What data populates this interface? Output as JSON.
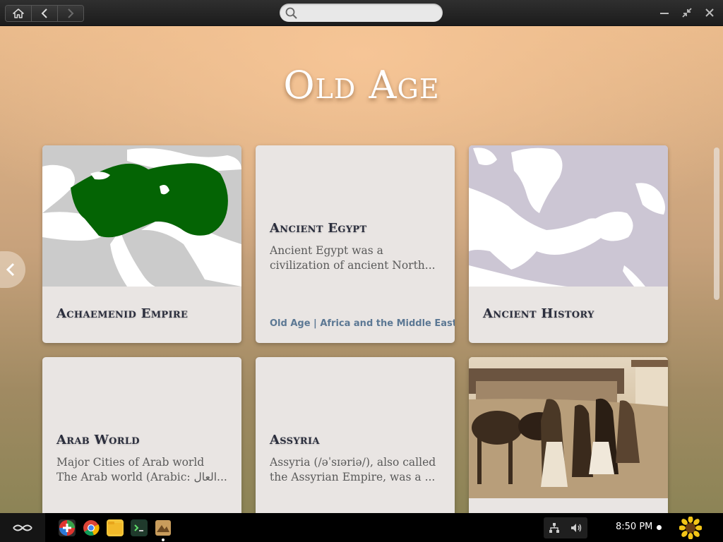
{
  "topbar": {
    "search": {
      "value": "",
      "placeholder": ""
    },
    "icons": {
      "home": "home-icon",
      "back": "back-arrow-icon",
      "forward": "forward-arrow-icon",
      "search": "search-icon",
      "minimize": "minimize-icon",
      "unmaximize": "unmaximize-icon",
      "close": "close-icon"
    }
  },
  "page": {
    "title": "Old Age"
  },
  "cards": [
    {
      "title": "Achaemenid Empire",
      "image": "map-achaemenid-empire"
    },
    {
      "title": "Ancient Egypt",
      "desc_line1": "Ancient Egypt was a",
      "desc_line2": "civilization of ancient North...",
      "meta": "Old Age | Africa and the Middle East"
    },
    {
      "title": "Ancient History",
      "image": "map-europe-mediterranean"
    },
    {
      "title": "Arab World",
      "desc_line1": "Major Cities of Arab world",
      "desc_line2": "The Arab world (Arabic: العال..."
    },
    {
      "title": "Assyria",
      "desc_line1": "Assyria (/əˈsɪəriə/), also called",
      "desc_line2": "the Assyrian Empire, was a ..."
    },
    {
      "title": "",
      "image": "historic-photo-horses-people"
    }
  ],
  "taskbar": {
    "clock": "8:50 PM",
    "apps": [
      "app-store-icon",
      "chrome-icon",
      "files-icon",
      "terminal-icon",
      "encyclopedia-icon"
    ],
    "tray": [
      "network-icon",
      "volume-icon"
    ],
    "colors": {
      "accent": "#5c7894",
      "card_bg": "#e9e5e3",
      "map_green": "#046404"
    }
  }
}
